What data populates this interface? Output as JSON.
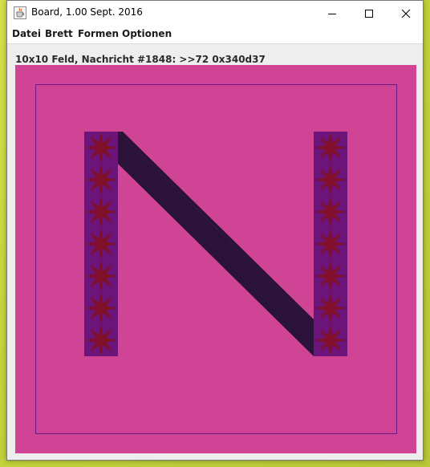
{
  "window": {
    "title": "Board, 1.00 Sept. 2016"
  },
  "menu": {
    "items": [
      "Datei",
      "Brett",
      "Formen",
      "Optionen"
    ]
  },
  "status": {
    "text": "10x10 Feld, Nachricht #1848: >>72 0x340d37"
  },
  "board": {
    "rows": 10,
    "cols": 10,
    "colors": {
      "background": "#cf4494",
      "border": "#6b1a8a",
      "column_fill": "#6b1479",
      "star": "#7f0f2a",
      "diagonal": "#2a1238"
    },
    "icons": {
      "app": "java-cup-icon",
      "minimize": "minimize-icon",
      "maximize": "maximize-icon",
      "close": "close-icon",
      "star": "star-icon"
    }
  }
}
